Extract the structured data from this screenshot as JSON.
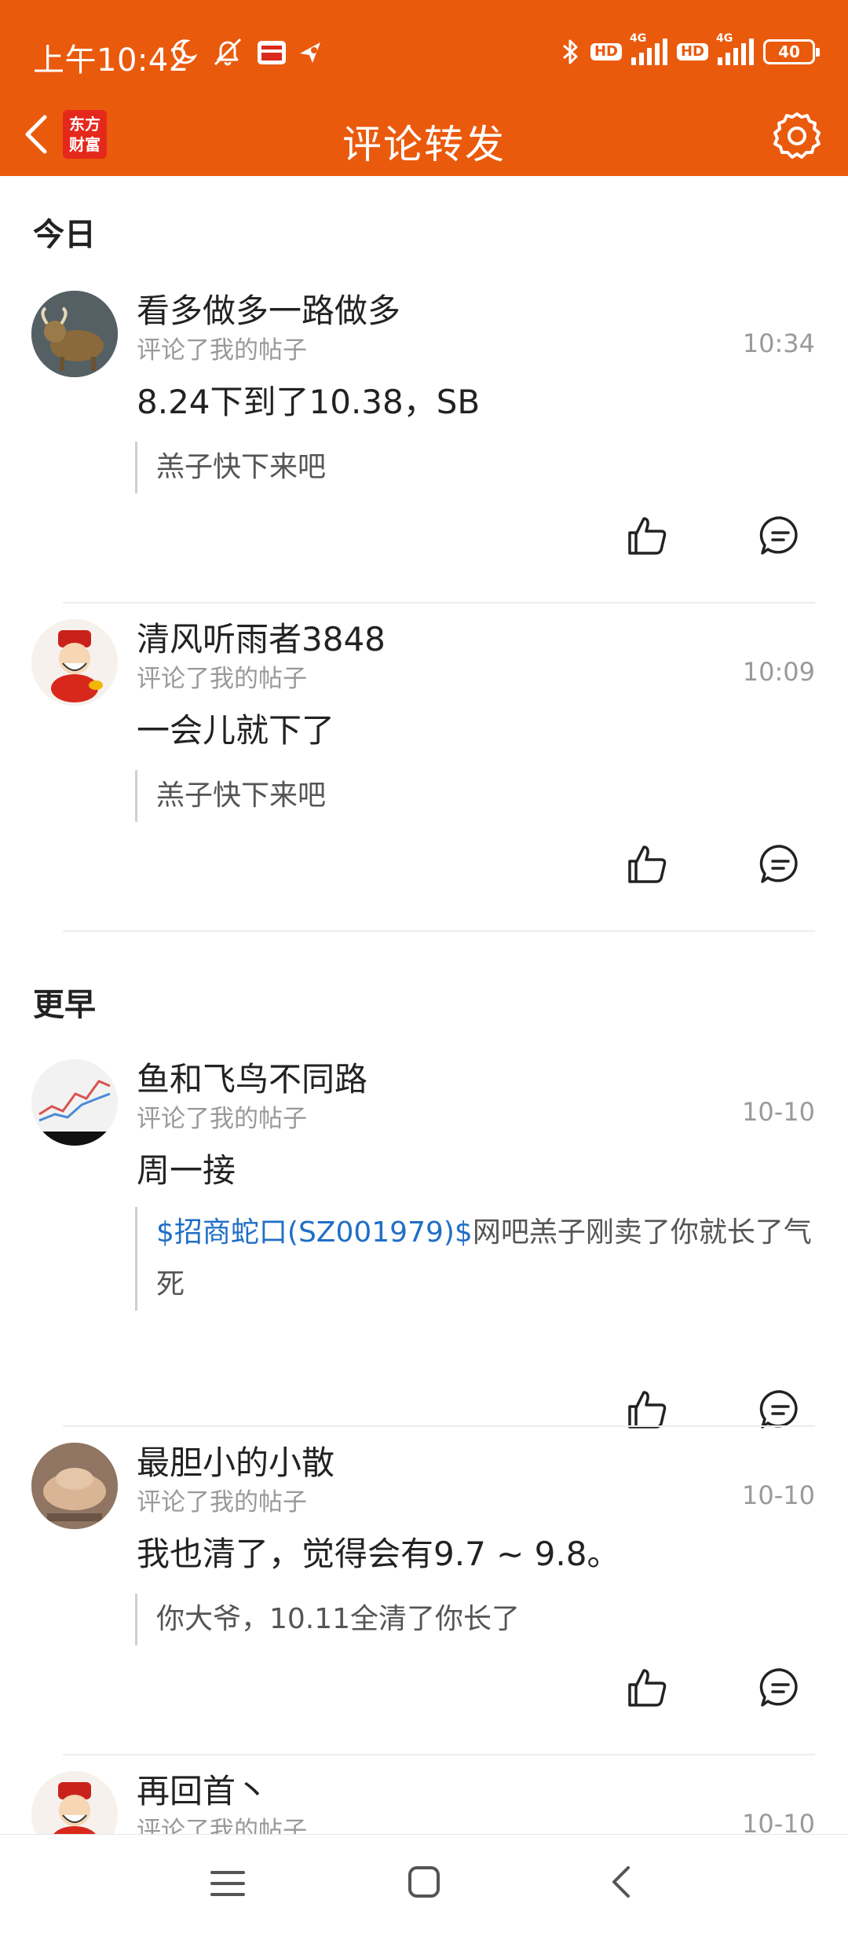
{
  "status_bar": {
    "time": "上午10:42",
    "network1": "4G",
    "network2": "4G",
    "hd1": "HD",
    "hd2": "HD",
    "battery": "40"
  },
  "header": {
    "title": "评论转发",
    "brand_line1": "东方",
    "brand_line2": "财富"
  },
  "sections": {
    "today": "今日",
    "earlier": "更早"
  },
  "items": [
    {
      "name": "看多做多一路做多",
      "action": "评论了我的帖子",
      "time": "10:34",
      "content": "8.24下到了10.38，SB",
      "quote": "羔子快下来吧"
    },
    {
      "name": "清风听雨者3848",
      "action": "评论了我的帖子",
      "time": "10:09",
      "content": "一会儿就下了",
      "quote": "羔子快下来吧"
    },
    {
      "name": "鱼和飞鸟不同路",
      "action": "评论了我的帖子",
      "time": "10-10",
      "content": "周一接",
      "quote_link": "$招商蛇口(SZ001979)$",
      "quote_rest": "网吧羔子刚卖了你就长了气死"
    },
    {
      "name": "最胆小的小散",
      "action": "评论了我的帖子",
      "time": "10-10",
      "content": "我也清了，觉得会有9.7 ~ 9.8。",
      "quote": "你大爷，10.11全清了你长了"
    },
    {
      "name": "再回首丶",
      "action": "评论了我的帖子",
      "time": "10-10"
    }
  ],
  "colors": {
    "header_bg": "#ea5a0d",
    "link": "#1f6fc6",
    "brand_red": "#e5281c"
  }
}
